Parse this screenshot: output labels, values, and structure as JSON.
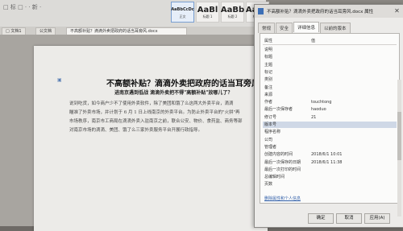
{
  "ribbon": {
    "quick_text": "□ 标 □ · · 新 ·",
    "styles": [
      {
        "big": "AaBbCcDc",
        "label": "正文",
        "selected": true
      },
      {
        "big": "AaBl",
        "label": "标题 1",
        "selected": false
      },
      {
        "big": "AaBb",
        "label": "标题 2",
        "selected": false
      },
      {
        "big": "AaBb",
        "label": "标题 3",
        "selected": false
      }
    ]
  },
  "tabs": [
    {
      "label": "□ 文档1",
      "active": false
    },
    {
      "label": "公文档",
      "active": false
    },
    {
      "label": "不高额补贴？滴滴外卖把政府的话当耳旁风.docx",
      "active": true
    }
  ],
  "document": {
    "title": "不高额补贴？滴滴外卖把政府的话当耳旁风",
    "subtitle": "进南京遇到低战 滴滴外卖把不得\"高额补贴\"放哪儿了？",
    "lines": [
      "说到吃货，如今商户少不了使用外卖软件，除了美团和饿了么这两大外卖平台，滴滴",
      "瞄准了外卖市场，并计划于 6 月 1 日上线南京的外卖平台。为防止外卖平台的\"火拼\"再",
      "市场秩序，南京市工商局在滴滴外卖入驻南京之前，联合公安、物价、食药监、商务等部",
      "对南京市场的滴滴、美团、饿了么三家外卖服务平台开展行政指导。"
    ]
  },
  "dialog": {
    "title": "不高额补贴？滴滴外卖把政府的话当耳旁风.docx 属性",
    "tabs": [
      "常规",
      "安全",
      "详细信息",
      "以前的版本"
    ],
    "active_tab": "详细信息",
    "head_prop": "属性",
    "head_val": "值",
    "rows": [
      {
        "k": "说明",
        "v": "",
        "hl": false
      },
      {
        "k": "标题",
        "v": "",
        "hl": false
      },
      {
        "k": "主题",
        "v": "",
        "hl": false
      },
      {
        "k": "标记",
        "v": "",
        "hl": false
      },
      {
        "k": "类别",
        "v": "",
        "hl": false
      },
      {
        "k": "备注",
        "v": "",
        "hl": false
      },
      {
        "k": "来源",
        "v": "",
        "hl": false
      },
      {
        "k": "作者",
        "v": "touchtong",
        "hl": false
      },
      {
        "k": "最后一次保存者",
        "v": "haoduo",
        "hl": false
      },
      {
        "k": "修订号",
        "v": "21",
        "hl": false
      },
      {
        "k": "版本号",
        "v": "",
        "hl": true
      },
      {
        "k": "程序名称",
        "v": "",
        "hl": false
      },
      {
        "k": "公司",
        "v": "",
        "hl": false
      },
      {
        "k": "管理者",
        "v": "",
        "hl": false
      },
      {
        "k": "创建内容的时间",
        "v": "2018/6/1 10:01",
        "hl": false
      },
      {
        "k": "最后一次保存的日期",
        "v": "2018/6/1 11:38",
        "hl": false
      },
      {
        "k": "最后一次打印的时间",
        "v": "",
        "hl": false
      },
      {
        "k": "总编辑时间",
        "v": "",
        "hl": false
      },
      {
        "k": "页数",
        "v": "",
        "hl": false
      }
    ],
    "remove_link": "删除属性和个人信息",
    "ok": "确定",
    "cancel": "取消",
    "apply": "应用(A)",
    "close_glyph": "✕"
  }
}
